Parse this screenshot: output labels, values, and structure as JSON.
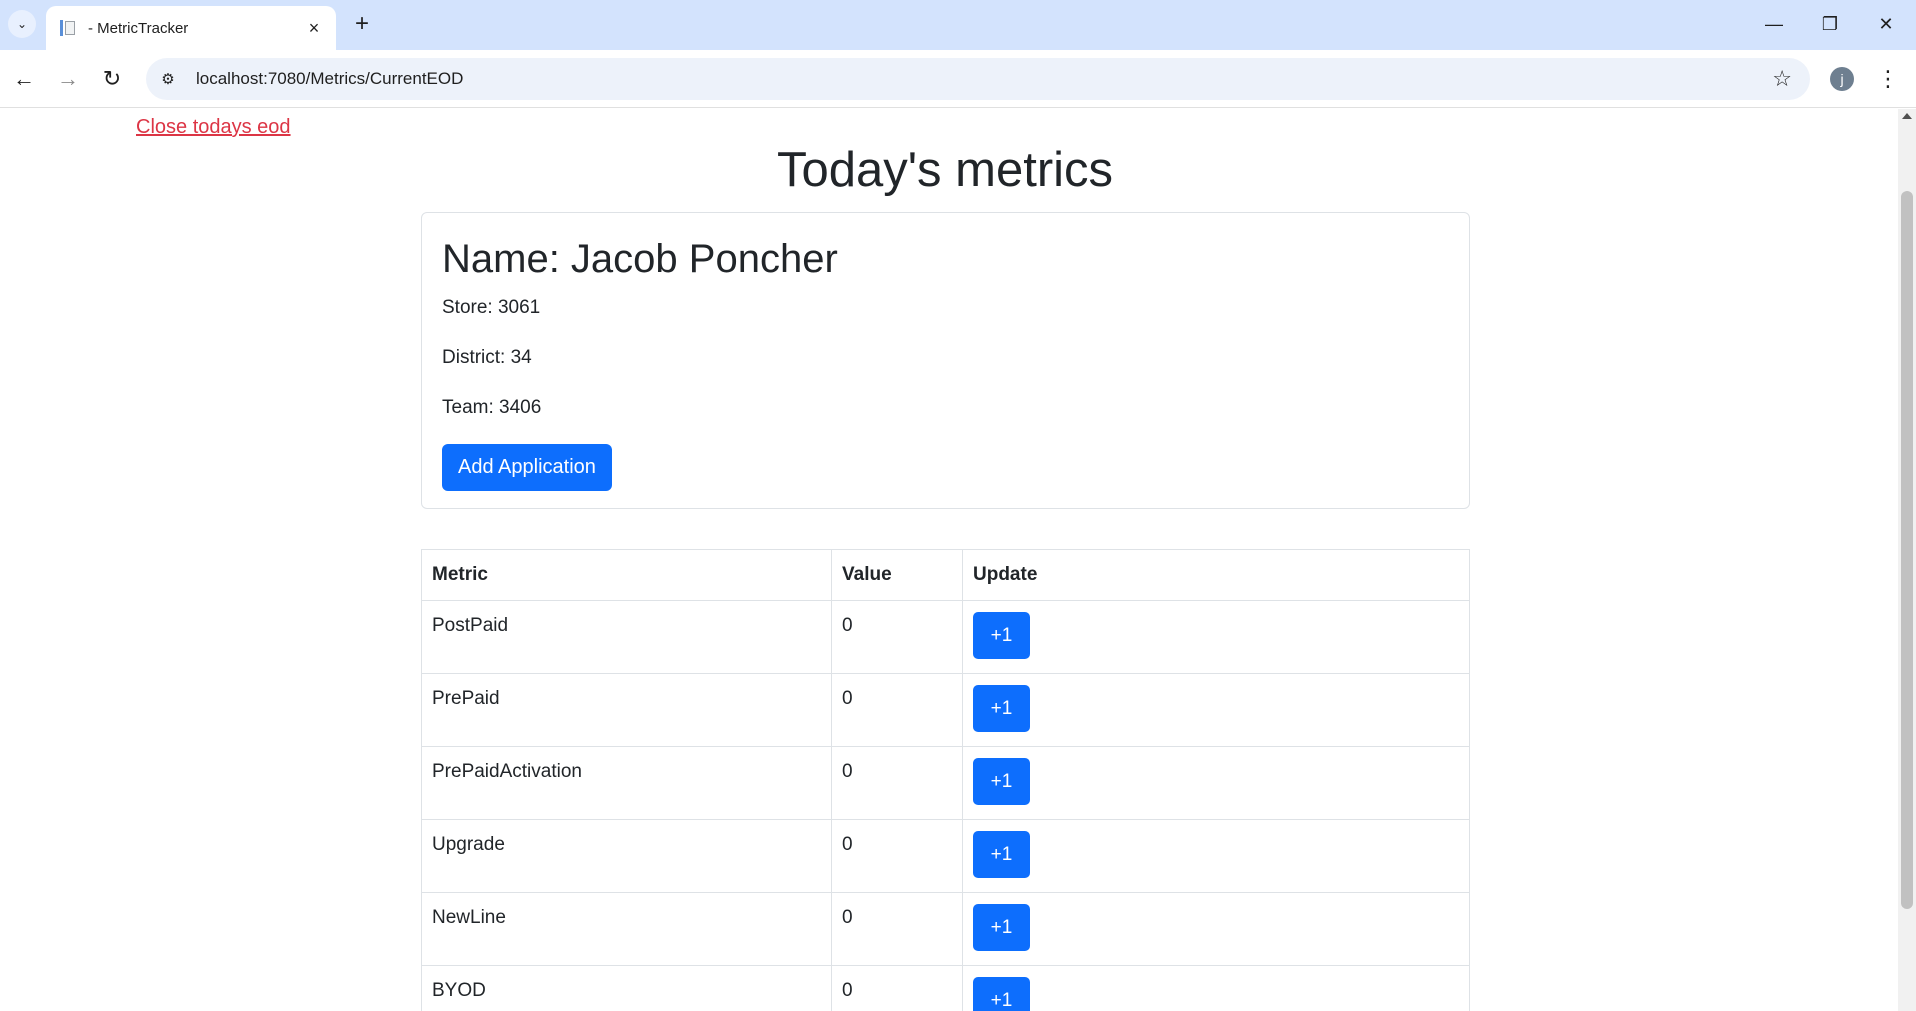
{
  "browser": {
    "tab_title": "- MetricTracker",
    "tab_close_icon": "×",
    "new_tab_icon": "+",
    "url": "localhost:7080/Metrics/CurrentEOD",
    "profile_initial": "j",
    "icons": {
      "back": "←",
      "forward": "→",
      "reload": "↻",
      "star": "☆",
      "menu": "⋮",
      "minimize": "—",
      "restore": "❐",
      "close": "✕",
      "tab_list": "⌄",
      "site_info": "⚙"
    }
  },
  "page": {
    "close_eod_link": "Close todays eod",
    "title": "Today's metrics",
    "profile_card": {
      "name": "Name: Jacob Poncher",
      "store": "Store: 3061",
      "district": "District: 34",
      "team": "Team: 3406",
      "add_button": "Add Application"
    },
    "table": {
      "headers": [
        "Metric",
        "Value",
        "Update"
      ],
      "rows": [
        {
          "metric": "PostPaid",
          "value": "0",
          "button": "+1"
        },
        {
          "metric": "PrePaid",
          "value": "0",
          "button": "+1"
        },
        {
          "metric": "PrePaidActivation",
          "value": "0",
          "button": "+1"
        },
        {
          "metric": "Upgrade",
          "value": "0",
          "button": "+1"
        },
        {
          "metric": "NewLine",
          "value": "0",
          "button": "+1"
        },
        {
          "metric": "BYOD",
          "value": "0",
          "button": "+1"
        }
      ]
    }
  },
  "colors": {
    "primary": "#0d6efd",
    "danger_link": "#dc3545",
    "tabbar": "#d3e3fd",
    "omnibox": "#edf2fa"
  }
}
